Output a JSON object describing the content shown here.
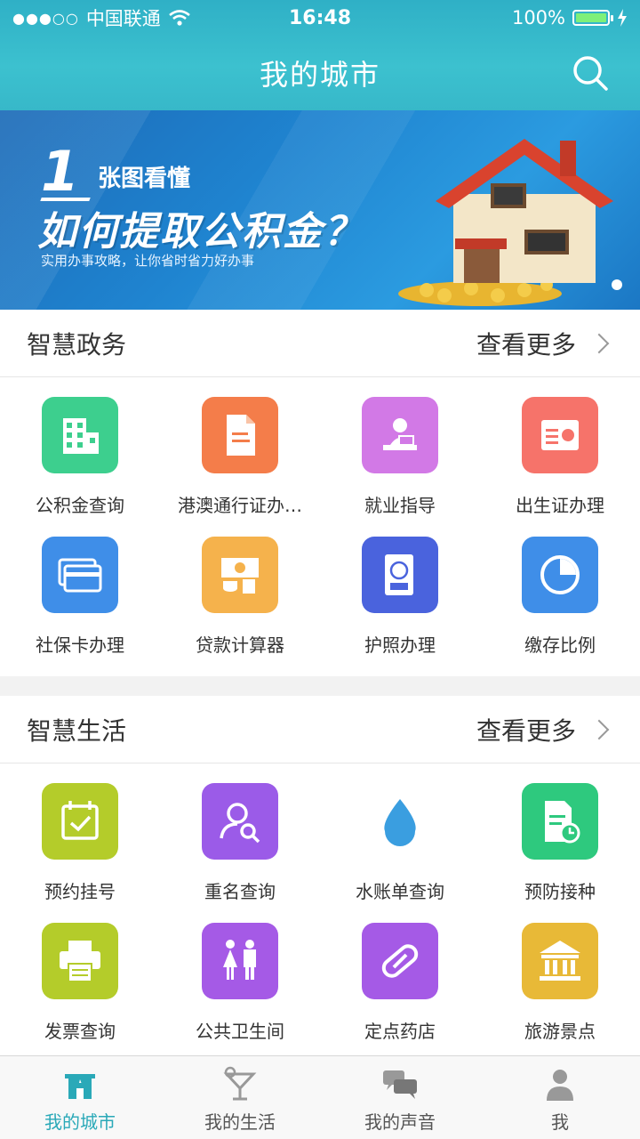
{
  "status_bar": {
    "signal": "●●●○○",
    "carrier": "中国联通",
    "time": "16:48",
    "battery": "100%"
  },
  "navbar": {
    "title": "我的城市"
  },
  "banner": {
    "number": "1",
    "subtitle": "张图看懂",
    "headline": "如何提取公积金？",
    "tagline": "实用办事攻略，让你省时省力好办事"
  },
  "gov": {
    "title": "智慧政务",
    "more": "查看更多",
    "items": [
      {
        "label": "公积金查询",
        "color": "#3dcf8e",
        "icon": "building-icon"
      },
      {
        "label": "港澳通行证办…",
        "color": "#f47d4a",
        "icon": "document-icon"
      },
      {
        "label": "就业指导",
        "color": "#d279e6",
        "icon": "worker-desk-icon"
      },
      {
        "label": "出生证办理",
        "color": "#f6736a",
        "icon": "id-card-icon"
      },
      {
        "label": "社保卡办理",
        "color": "#3f8ee8",
        "icon": "cards-icon"
      },
      {
        "label": "贷款计算器",
        "color": "#f5b24c",
        "icon": "money-coins-icon"
      },
      {
        "label": "护照办理",
        "color": "#4a63dd",
        "icon": "passport-icon"
      },
      {
        "label": "缴存比例",
        "color": "#3f8ee8",
        "icon": "pie-chart-icon"
      }
    ]
  },
  "life": {
    "title": "智慧生活",
    "more": "查看更多",
    "items": [
      {
        "label": "预约挂号",
        "color": "#b4cc2a",
        "icon": "calendar-check-icon"
      },
      {
        "label": "重名查询",
        "color": "#9b5be8",
        "icon": "user-search-icon"
      },
      {
        "label": "水账单查询",
        "color": "#3a9ee0",
        "icon": "water-drop-icon"
      },
      {
        "label": "预防接种",
        "color": "#2ec97e",
        "icon": "form-clock-icon"
      },
      {
        "label": "发票查询",
        "color": "#b4cc2a",
        "icon": "printer-icon"
      },
      {
        "label": "公共卫生间",
        "color": "#a55ae6",
        "icon": "restroom-icon"
      },
      {
        "label": "定点药店",
        "color": "#a55ae6",
        "icon": "pill-icon"
      },
      {
        "label": "旅游景点",
        "color": "#e8b937",
        "icon": "landmark-icon"
      }
    ]
  },
  "tabbar": {
    "items": [
      {
        "label": "我的城市",
        "icon": "city-icon",
        "active": true
      },
      {
        "label": "我的生活",
        "icon": "cocktail-icon",
        "active": false
      },
      {
        "label": "我的声音",
        "icon": "chat-bubbles-icon",
        "active": false
      },
      {
        "label": "我",
        "icon": "person-icon",
        "active": false
      }
    ]
  },
  "colors": {
    "accent": "#2aa9b8",
    "header": "#35b8c9"
  }
}
